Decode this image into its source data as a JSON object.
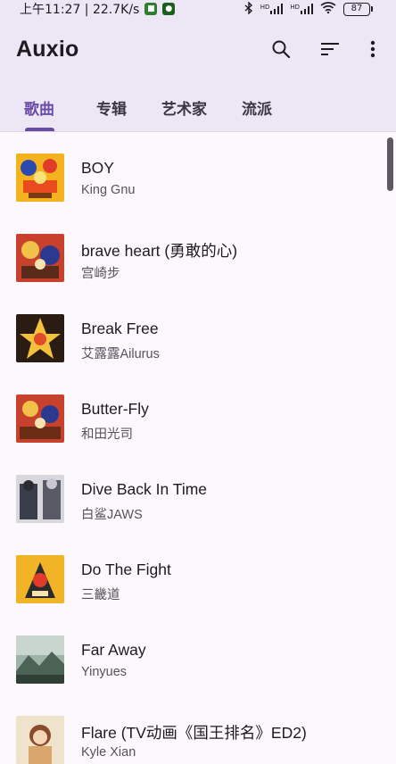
{
  "status_bar": {
    "time_speed": "上午11:27 | 22.7K/s",
    "signal1_label": "HD",
    "signal2_label": "HD",
    "battery": "87"
  },
  "app": {
    "title": "Auxio",
    "icons": [
      "search-icon",
      "sort-icon",
      "more-vert-icon"
    ]
  },
  "tabs": [
    {
      "label": "歌曲",
      "active": true
    },
    {
      "label": "专辑",
      "active": false
    },
    {
      "label": "艺术家",
      "active": false
    },
    {
      "label": "流派",
      "active": false
    }
  ],
  "accent_color": "#6a4aa7",
  "songs": [
    {
      "title": "BOY",
      "artist": "King Gnu"
    },
    {
      "title": "brave heart (勇敢的心)",
      "artist": "宫崎步"
    },
    {
      "title": "Break Free",
      "artist": "艾露露Ailurus"
    },
    {
      "title": "Butter-Fly",
      "artist": "和田光司"
    },
    {
      "title": "Dive Back In Time",
      "artist": "白鲨JAWS"
    },
    {
      "title": "Do The Fight",
      "artist": "三畿道"
    },
    {
      "title": "Far Away",
      "artist": "Yinyues"
    },
    {
      "title": "Flare (TV动画《国王排名》ED2)",
      "artist": "Kyle Xian"
    }
  ]
}
